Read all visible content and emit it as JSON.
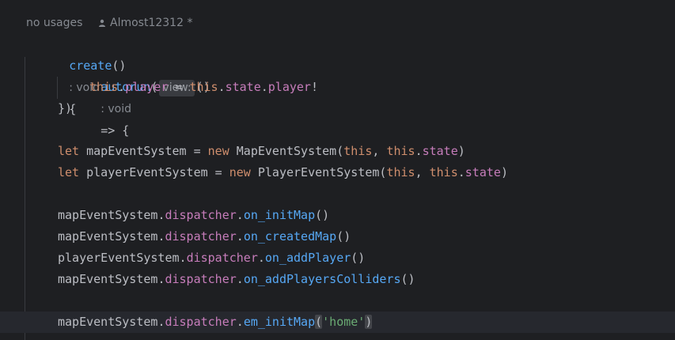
{
  "meta": {
    "usages": "no usages",
    "author": "Almost12312 *"
  },
  "code": {
    "l1_fn": "create",
    "l1_parens": "()",
    "l1_type_hint": ": void",
    "l1_brace": "{",
    "l2_fn": "autorun",
    "l2_open": "(",
    "l2_param_hint": "view:",
    "l2_arrow_parens": "()",
    "l2_type_hint": ": void",
    "l2_arrow": "=> {",
    "l3_this1": "this",
    "l3_dot1": ".",
    "l3_player1": "player",
    "l3_eq": " = ",
    "l3_this2": "this",
    "l3_dot2": ".",
    "l3_state": "state",
    "l3_dot3": ".",
    "l3_player2": "player",
    "l3_bang": "!",
    "l4_close": "})",
    "l6_let": "let",
    "l6_var": " mapEventSystem = ",
    "l6_new": "new",
    "l6_cls": " MapEventSystem(",
    "l6_this1": "this",
    "l6_comma": ", ",
    "l6_this2": "this",
    "l6_dot": ".",
    "l6_state": "state",
    "l6_close": ")",
    "l7_let": "let",
    "l7_var": " playerEventSystem = ",
    "l7_new": "new",
    "l7_cls": " PlayerEventSystem(",
    "l7_this1": "this",
    "l7_comma": ", ",
    "l7_this2": "this",
    "l7_dot": ".",
    "l7_state": "state",
    "l7_close": ")",
    "l9_obj": "mapEventSystem",
    "l9_dot1": ".",
    "l9_prop": "dispatcher",
    "l9_dot2": ".",
    "l9_fn": "on_initMap",
    "l9_parens": "()",
    "l10_obj": "mapEventSystem",
    "l10_dot1": ".",
    "l10_prop": "dispatcher",
    "l10_dot2": ".",
    "l10_fn": "on_createdMap",
    "l10_parens": "()",
    "l11_obj": "playerEventSystem",
    "l11_dot1": ".",
    "l11_prop": "dispatcher",
    "l11_dot2": ".",
    "l11_fn": "on_addPlayer",
    "l11_parens": "()",
    "l12_obj": "mapEventSystem",
    "l12_dot1": ".",
    "l12_prop": "dispatcher",
    "l12_dot2": ".",
    "l12_fn": "on_addPlayersColliders",
    "l12_parens": "()",
    "l14_obj": "mapEventSystem",
    "l14_dot1": ".",
    "l14_prop": "dispatcher",
    "l14_dot2": ".",
    "l14_fn": "em_initMap",
    "l14_open": "(",
    "l14_str": "'home'",
    "l14_close": ")"
  },
  "colors": {
    "background": "#1e1f22",
    "function": "#56a8f5",
    "keyword": "#cf8e6d",
    "property": "#c77dbb",
    "string": "#6aab73",
    "plain": "#bcbec4"
  },
  "icons": {
    "author": "person-icon"
  }
}
